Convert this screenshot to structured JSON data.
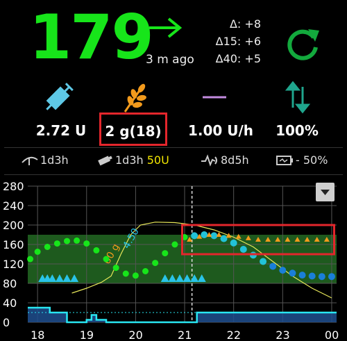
{
  "bg": {
    "value": "179",
    "color": "#17e51a"
  },
  "trend": {
    "icon": "arrow-right-icon",
    "minutes_ago": "3 m ago"
  },
  "deltas": {
    "delta": "Δ: +8",
    "delta15": "Δ15: +6",
    "delta40": "Δ40: +5"
  },
  "refresh": {
    "icon": "refresh-icon"
  },
  "summary": {
    "insulin": {
      "icon": "syringe-icon",
      "value": "2.72 U"
    },
    "carbs": {
      "icon": "wheat-icon",
      "value": "2 g(18)"
    },
    "basal": {
      "icon": "basal-line-icon",
      "value": "1.00 U/h"
    },
    "profile": {
      "icon": "up-down-arrows-icon",
      "value": "100%"
    }
  },
  "status": {
    "cannula": {
      "icon": "cannula-icon",
      "value": "1d3h"
    },
    "reservoir": {
      "icon": "reservoir-icon",
      "value": "1d3h",
      "level": "50U"
    },
    "sensor": {
      "icon": "sensor-icon",
      "value": "8d5h"
    },
    "battery": {
      "icon": "battery-icon",
      "value": "- 50%"
    }
  },
  "colors": {
    "green": "#17e51a",
    "cyan": "#29c4e8",
    "orange": "#f29a1c",
    "red": "#e4262c",
    "band": "#1e5a1e"
  },
  "chart_data": {
    "type": "line",
    "y_ticks": [
      "280",
      "240",
      "200",
      "160",
      "120",
      "80",
      "40",
      "0"
    ],
    "x_ticks": [
      "18",
      "19",
      "20",
      "21",
      "22",
      "23",
      "00"
    ],
    "ylim": [
      0,
      280
    ],
    "target_range": [
      80,
      180
    ],
    "annotations": [
      {
        "text": "4.50",
        "x": 19.85,
        "y": 150
      },
      {
        "text": "60 g",
        "x": 19.45,
        "y": 118
      }
    ],
    "bg_history": {
      "x": [
        17.85,
        18.0,
        18.2,
        18.4,
        18.6,
        18.8,
        19.0,
        19.2,
        19.4,
        19.6,
        19.8,
        20.0,
        20.2,
        20.4,
        20.6,
        20.8,
        21.0
      ],
      "y": [
        130,
        145,
        155,
        162,
        167,
        168,
        162,
        148,
        130,
        112,
        100,
        96,
        105,
        122,
        142,
        160,
        175
      ]
    },
    "bg_prediction": {
      "x": [
        21.2,
        21.4,
        21.6,
        21.8,
        22.0,
        22.2,
        22.4,
        22.6,
        22.8,
        23.0,
        23.2,
        23.4,
        23.6,
        23.8,
        24.0
      ],
      "y": [
        178,
        180,
        178,
        172,
        163,
        150,
        138,
        125,
        115,
        107,
        101,
        97,
        95,
        94,
        94
      ]
    },
    "iob_line": {
      "x": [
        18.7,
        19.0,
        19.3,
        19.5,
        19.7,
        19.9,
        20.1,
        20.4,
        20.8,
        21.2,
        21.6,
        22.0,
        22.4,
        22.8,
        23.2,
        23.6,
        24.0
      ],
      "y": [
        60,
        70,
        82,
        95,
        140,
        180,
        200,
        206,
        205,
        200,
        190,
        175,
        155,
        125,
        95,
        70,
        50
      ]
    },
    "carb_prediction": {
      "x": [
        21.1,
        21.3,
        21.5,
        21.7,
        21.9,
        22.1,
        22.3,
        22.5,
        22.7,
        22.9,
        23.1,
        23.3,
        23.5,
        23.7,
        23.9
      ],
      "y": [
        170,
        176,
        180,
        180,
        178,
        176,
        173,
        170,
        170,
        170,
        170,
        170,
        170,
        170,
        170
      ]
    },
    "boluses_x": [
      18.1,
      18.2,
      18.3,
      18.45,
      18.6,
      18.75,
      20.6,
      20.75,
      20.9,
      21.05,
      21.2,
      21.35
    ],
    "basal_steps": {
      "x": [
        17.8,
        18.25,
        18.25,
        18.6,
        18.6,
        19.0,
        19.0,
        19.1,
        19.1,
        19.2,
        19.2,
        19.4,
        19.4,
        21.25,
        21.25,
        24.1
      ],
      "y": [
        30,
        30,
        20,
        20,
        0,
        0,
        5,
        5,
        15,
        15,
        5,
        5,
        0,
        0,
        20,
        20
      ]
    }
  }
}
